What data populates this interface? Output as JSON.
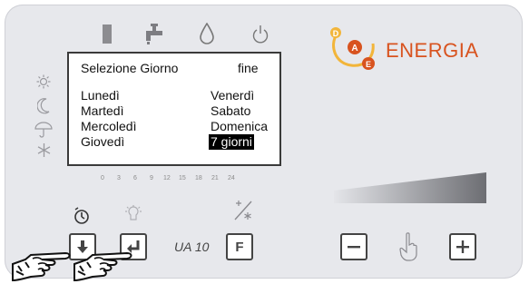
{
  "brand": {
    "text": "ENERGIA",
    "logo_letters": [
      "D",
      "A",
      "E"
    ],
    "color": "#d8531f"
  },
  "lcd": {
    "header_left": "Selezione Giorno",
    "header_right": "fine",
    "days_left": [
      "Lunedì",
      "Martedì",
      "Mercoledì",
      "Giovedì"
    ],
    "days_right": [
      "Venerdì",
      "Sabato",
      "Domenica",
      "7 giorni"
    ],
    "selected": "7 giorni"
  },
  "hour_scale": [
    "0",
    "3",
    "6",
    "9",
    "12",
    "15",
    "18",
    "21",
    "24"
  ],
  "model_label": "UA 10",
  "buttons": {
    "f_label": "F"
  },
  "icons": {
    "top": [
      "radiator-icon",
      "faucet-icon",
      "drop-icon",
      "power-icon"
    ],
    "left": [
      "sun-icon",
      "moon-icon",
      "umbrella-icon",
      "snowflake-icon"
    ]
  }
}
